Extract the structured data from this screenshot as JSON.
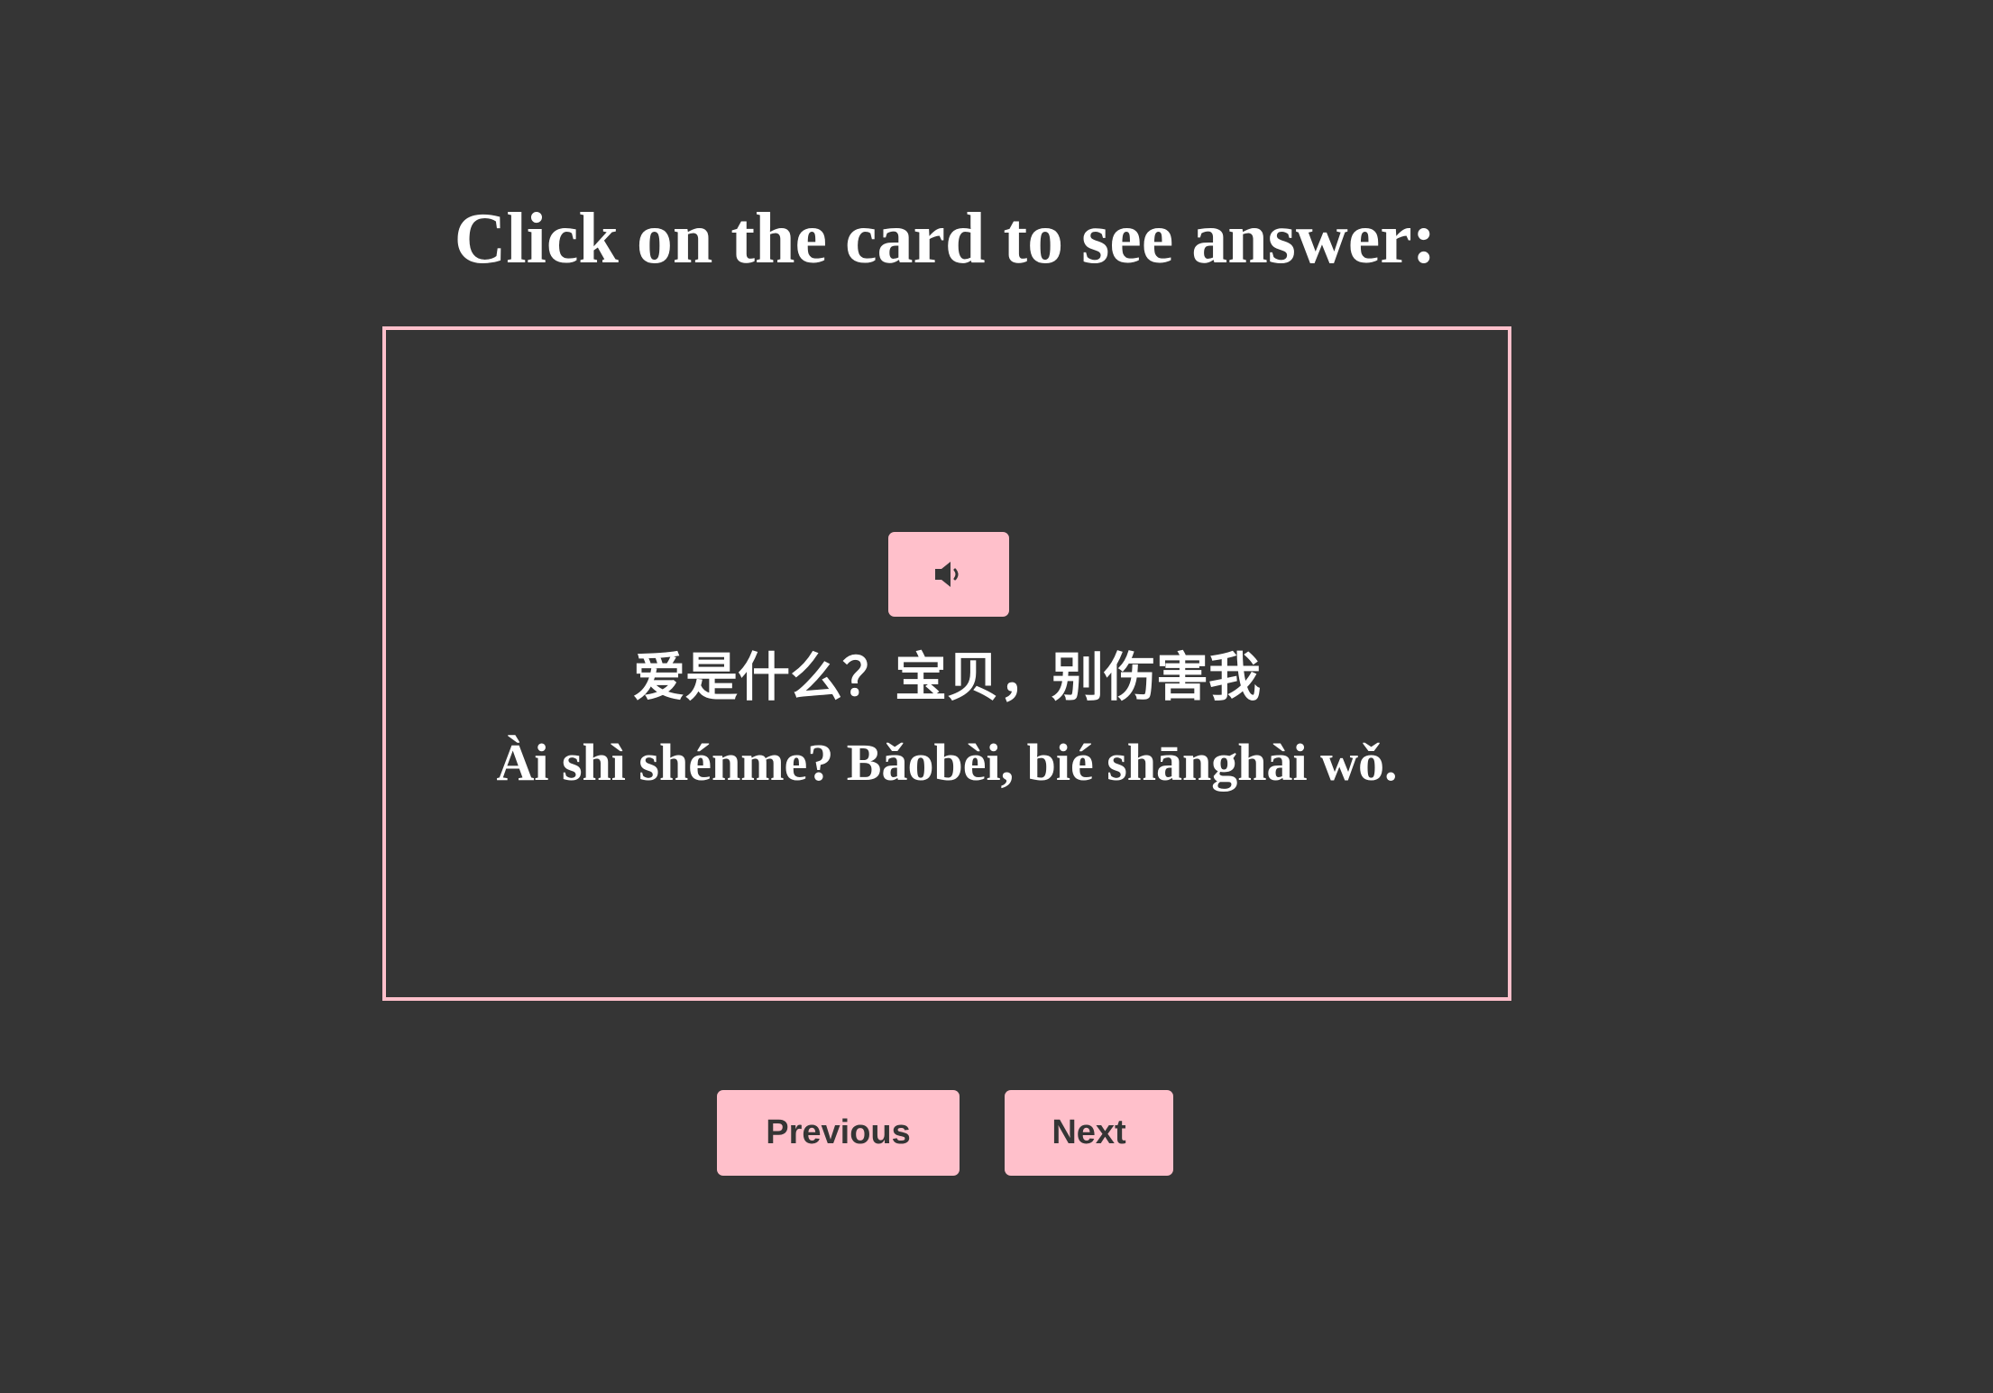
{
  "prompt": "Click on the card to see answer:",
  "card": {
    "audio_icon": "speaker-icon",
    "hanzi": "爱是什么？宝贝，别伤害我",
    "pinyin": "Ài shì shénme? Bǎobèi, bié shānghài wǒ."
  },
  "navigation": {
    "previous_label": "Previous",
    "next_label": "Next"
  },
  "colors": {
    "background": "#353535",
    "accent": "#ffc0cb",
    "text": "#ffffff",
    "button_text": "#353535"
  }
}
